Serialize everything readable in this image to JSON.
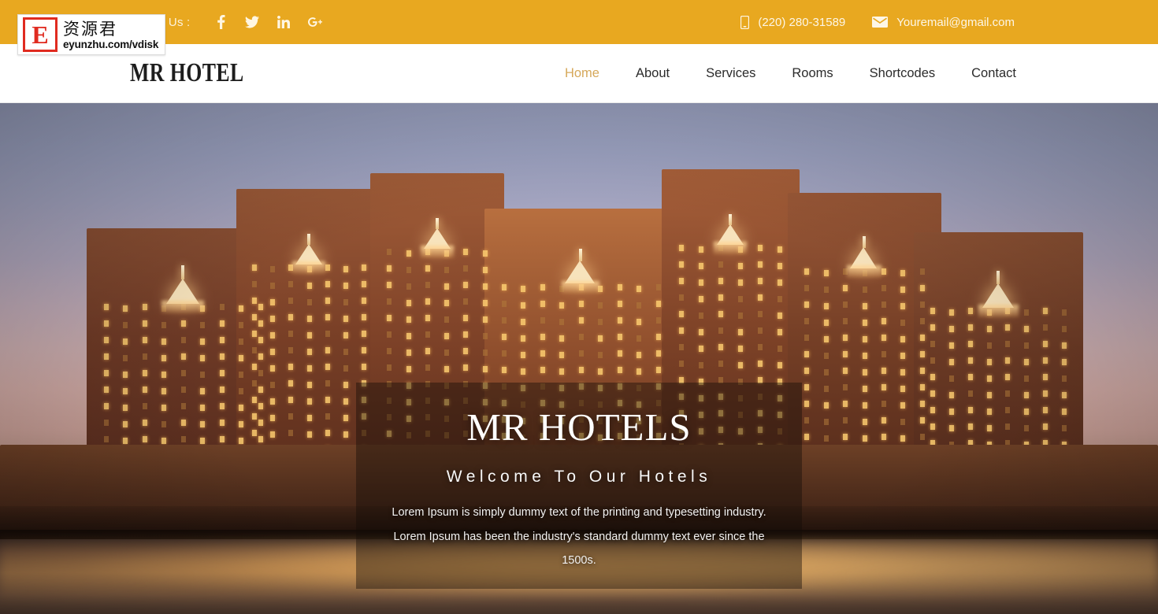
{
  "topbar": {
    "follow_label": "Follow Us :",
    "socials": [
      {
        "name": "facebook-icon",
        "label": "Facebook"
      },
      {
        "name": "twitter-icon",
        "label": "Twitter"
      },
      {
        "name": "linkedin-icon",
        "label": "LinkedIn"
      },
      {
        "name": "googleplus-icon",
        "label": "Google Plus"
      }
    ],
    "phone": "(220) 280-31589",
    "email": "Youremail@gmail.com",
    "phone_icon": "mobile-phone-icon",
    "email_icon": "envelope-icon",
    "bg_color": "#e8a820",
    "text_color": "#fdf3dd"
  },
  "nav": {
    "brand": "MR HOTEL",
    "active_color": "#d6a85a",
    "items": [
      {
        "label": "Home",
        "active": true
      },
      {
        "label": "About",
        "active": false
      },
      {
        "label": "Services",
        "active": false
      },
      {
        "label": "Rooms",
        "active": false
      },
      {
        "label": "Shortcodes",
        "active": false
      },
      {
        "label": "Contact",
        "active": false
      }
    ]
  },
  "hero": {
    "title": "MR HOTELS",
    "subtitle": "Welcome To Our Hotels",
    "description": "Lorem Ipsum is simply dummy text of the printing and typesetting industry. Lorem Ipsum has been the industry's standard dummy text ever since the 1500s.",
    "image_alt": "Illuminated palace hotel resort at dusk reflected in water"
  },
  "watermark": {
    "logo_letter": "E",
    "brand_cn": "资源君",
    "url": "eyunzhu.com/vdisk",
    "accent_color": "#e02b20"
  }
}
